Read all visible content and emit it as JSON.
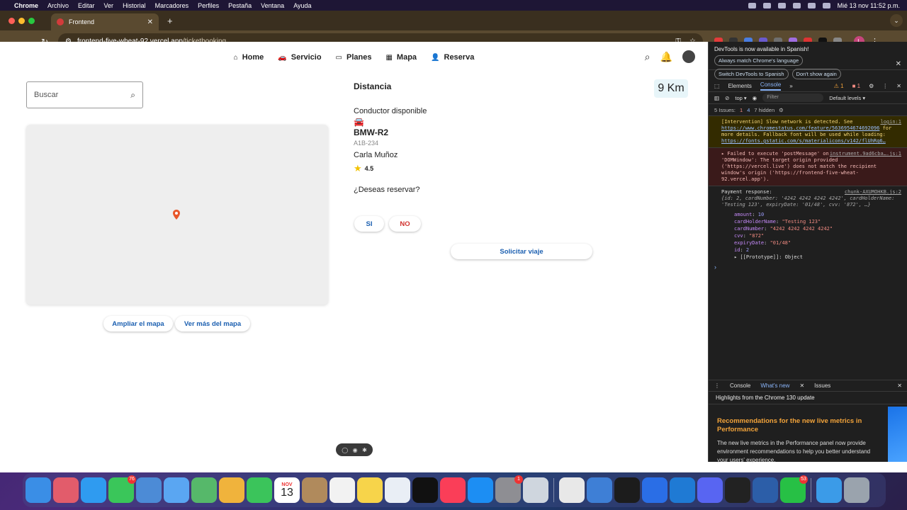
{
  "menubar": {
    "app": "Chrome",
    "items": [
      "Archivo",
      "Editar",
      "Ver",
      "Historial",
      "Marcadores",
      "Perfiles",
      "Pestaña",
      "Ventana",
      "Ayuda"
    ],
    "datetime": "Mié 13 nov 11:52 p.m."
  },
  "browser": {
    "tab_title": "Frontend",
    "url_host": "frontend-five-wheat-92.vercel.app",
    "url_path": "/ticketbooking",
    "profile_initial": "L"
  },
  "navbar": {
    "links": [
      {
        "icon": "⌂",
        "label": "Home"
      },
      {
        "icon": "🚗",
        "label": "Servicio"
      },
      {
        "icon": "▭",
        "label": "Planes"
      },
      {
        "icon": "▦",
        "label": "Mapa"
      },
      {
        "icon": "👤",
        "label": "Reserva"
      }
    ]
  },
  "search": {
    "placeholder": "Buscar"
  },
  "map": {
    "expand_label": "Ampliar el mapa",
    "more_label": "Ver más del mapa",
    "pin_color": "#e8572a"
  },
  "trip": {
    "distance_label": "Distancia",
    "distance_value": "9 Km",
    "driver_title": "Conductor disponible",
    "car_model": "BMW-R2",
    "plate": "A1B-234",
    "driver_name": "Carla Muñoz",
    "rating": "4.5",
    "question": "¿Deseas reservar?",
    "yes_label": "SI",
    "no_label": "NO",
    "request_label": "Solicitar viaje"
  },
  "devtools": {
    "banner_text": "DevTools is now available in Spanish!",
    "banner_btn1": "Always match Chrome's language",
    "banner_btn2": "Switch DevTools to Spanish",
    "banner_btn3": "Don't show again",
    "tabs": [
      "Elements",
      "Console"
    ],
    "warn_count": "1",
    "err_count": "1",
    "context": "top ▾",
    "filter_placeholder": "Filter",
    "levels": "Default levels ▾",
    "issues_label": "5 Issues:",
    "issues_err": "1",
    "issues_msg": "4",
    "hidden": "7 hidden",
    "log1_text": "[Intervention] Slow network is detected. See",
    "log1_link1": "https://www.chromestatus.com/feature/5636954674692096",
    "log1_mid": "for more details. Fallback font will be used while loading:",
    "log1_link2": "https://fonts.gstatic.com/s/materialicons/v142/flUhRq6…",
    "log1_src": "login:1",
    "log2_text": "▸ Failed to execute 'postMessage' on 'DOMWindow': The target origin provided ('https://vercel.live') does not match the recipient window's origin ('https://frontend-five-wheat-92.vercel.app').",
    "log2_src": "instrument.9ad6cba….js:1",
    "log3_title": "Payment response:",
    "log3_src": "chunk-AXUMOHKB.js:2",
    "log3_summary": "{id: 2, cardNumber: '4242 4242 4242 4242', cardHolderName: 'Testing 123', expiryDate: '01/48', cvv: '872', …}",
    "fields": [
      {
        "k": "amount",
        "v": "10",
        "t": "n"
      },
      {
        "k": "cardHolderName",
        "v": "\"Testing 123\"",
        "t": "s"
      },
      {
        "k": "cardNumber",
        "v": "\"4242 4242 4242 4242\"",
        "t": "s"
      },
      {
        "k": "cvv",
        "v": "\"872\"",
        "t": "s"
      },
      {
        "k": "expiryDate",
        "v": "\"01/48\"",
        "t": "s"
      },
      {
        "k": "id",
        "v": "2",
        "t": "n"
      }
    ],
    "prototype": "▸ [[Prototype]]: Object",
    "drawer_tabs": [
      "Console",
      "What's new",
      "Issues"
    ],
    "drawer_highlight": "Highlights from the Chrome 130 update",
    "drawer_heading": "Recommendations for the new live metrics in Performance",
    "drawer_text": "The new live metrics in the Performance panel now provide environment recommendations to help you better understand your users' experience."
  },
  "dock": {
    "messages_badge": "76",
    "calendar_month": "NOV",
    "calendar_day": "13",
    "settings_badge": "1",
    "whatsapp_badge": "53"
  }
}
